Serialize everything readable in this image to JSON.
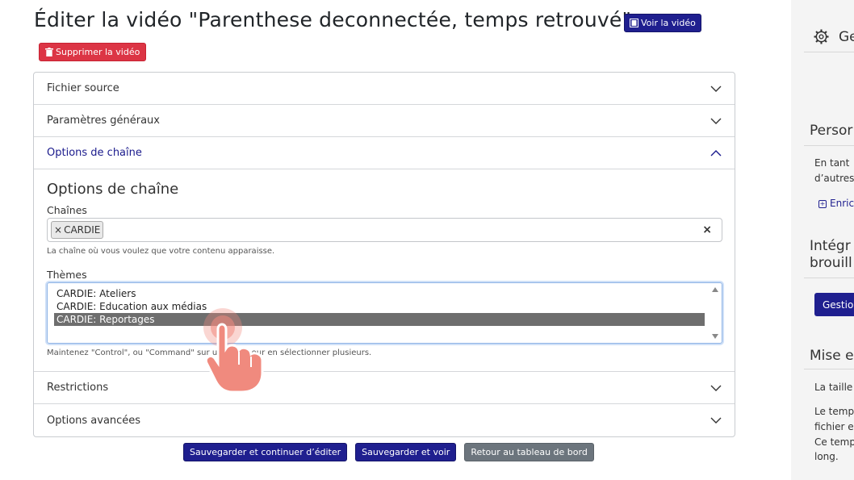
{
  "header": {
    "title": "Éditer la vidéo \"Parenthese deconnectée, temps retrouvé\"",
    "view_button": "Voir la vidéo",
    "delete_button": "Supprimer la vidéo"
  },
  "accordion": {
    "source_file": "Fichier source",
    "general_settings": "Paramètres généraux",
    "channel_options": "Options de chaîne",
    "restrictions": "Restrictions",
    "advanced_options": "Options avancées"
  },
  "channel_section": {
    "title": "Options de chaîne",
    "channels_label": "Chaînes",
    "channel_tags": [
      "CARDIE"
    ],
    "clear_symbol": "×",
    "channels_help": "La chaîne où vous voulez que votre contenu apparaisse.",
    "themes_label": "Thèmes",
    "theme_options": [
      "CARDIE: Ateliers",
      "CARDIE: Education aux médias",
      "CARDIE: Reportages"
    ],
    "selected_theme": "CARDIE: Reportages",
    "themes_help": "Maintenez \"Control\", ou \"Command\" sur un Mac, pour en sélectionner plusieurs."
  },
  "actions": {
    "save_continue": "Sauvegarder et continuer d’éditer",
    "save_view": "Sauvegarder et voir",
    "back_dashboard": "Retour au tableau de bord"
  },
  "sidebar": {
    "settings_heading": "Ge",
    "personalize_heading": "Persor",
    "personalize_text_1": "En tant",
    "personalize_text_2": "d’autres",
    "enrich_link": "Enric",
    "integrate_heading_1": "Intégr",
    "integrate_heading_2": "brouill",
    "manage_button": "Gestio",
    "setup_heading": "Mise e",
    "size_text": "La taille",
    "time_text_1": "Le temp",
    "time_text_2": "fichier e",
    "time_text_3": "Ce temp",
    "time_text_4": "long."
  },
  "colors": {
    "primary": "#1f1f8f",
    "danger": "#dc3545",
    "secondary": "#6c757d",
    "selected_option": "#6e6e6e",
    "hand_cursor": "#f08a7e"
  }
}
